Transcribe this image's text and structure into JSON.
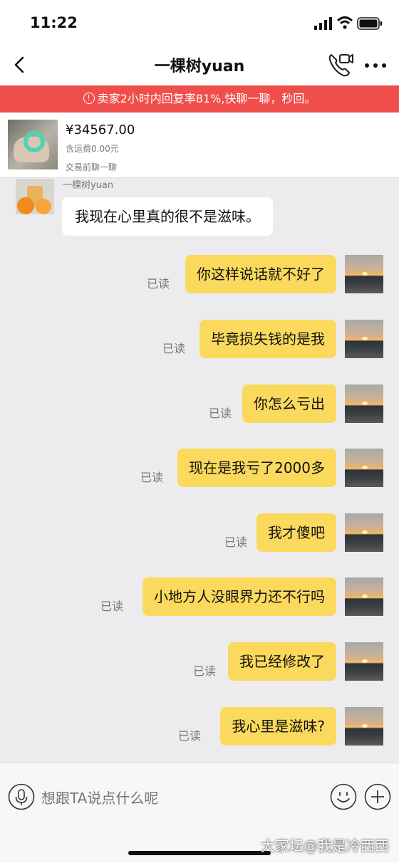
{
  "status_bar": {
    "time": "11:22"
  },
  "header": {
    "title": "一棵树yuan"
  },
  "notice": {
    "text": "卖家2小时内回复率81%,快聊一聊，秒回。"
  },
  "product": {
    "price": "¥34567.00",
    "shipping": "含运费0.00元",
    "chat_before_trade": "交易前聊一聊"
  },
  "incoming": {
    "sender_name": "一棵树yuan",
    "text": "我现在心里真的很不是滋味。"
  },
  "outgoing": [
    {
      "text": "你这样说话就不好了",
      "status": "已读"
    },
    {
      "text": "毕竟损失钱的是我",
      "status": "已读"
    },
    {
      "text": "你怎么亏出",
      "status": "已读"
    },
    {
      "text": "现在是我亏了2000多",
      "status": "已读"
    },
    {
      "text": "我才傻吧",
      "status": "已读"
    },
    {
      "text": "小地方人没眼界力还不行吗",
      "status": "已读"
    },
    {
      "text": "我已经修改了",
      "status": "已读"
    },
    {
      "text": "我心里是滋味?",
      "status": "已读"
    }
  ],
  "input": {
    "placeholder": "想跟TA说点什么呢"
  },
  "watermark": "大家坛@我是冷西西",
  "colors": {
    "notice_bg": "#ef4e4a",
    "bubble_out": "#fad95c",
    "background": "#ececee"
  }
}
